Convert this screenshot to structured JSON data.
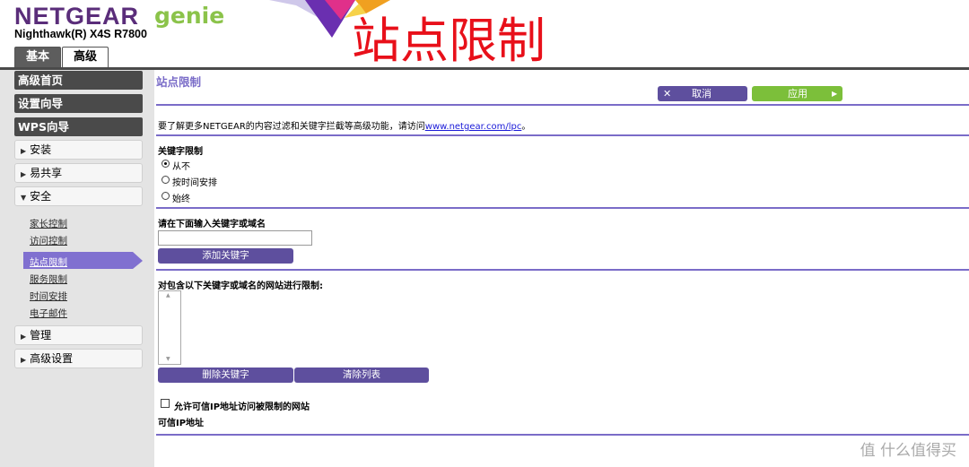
{
  "header": {
    "brand": "NETGEAR",
    "brand_genie": "genie",
    "model": "Nighthawk(R) X4S R7800",
    "banner_title": "站点限制",
    "tabs": [
      "基本",
      "高级"
    ]
  },
  "sidebar": {
    "dark_items": [
      "高级首页",
      "设置向导",
      "WPS向导"
    ],
    "sections": [
      "安装",
      "易共享",
      "安全"
    ],
    "security_sub": [
      "家长控制",
      "访问控制",
      "站点限制",
      "服务限制",
      "时间安排",
      "电子邮件"
    ],
    "bottom_sections": [
      "管理",
      "高级设置"
    ]
  },
  "main": {
    "title": "站点限制",
    "cancel_label": "取消",
    "apply_label": "应用",
    "info_prefix": "要了解更多NETGEAR的内容过滤和关键字拦截等高级功能，请访问",
    "info_link": "www.netgear.com/lpc",
    "info_suffix": "。",
    "keyword_block_label": "关键字限制",
    "radio_options": [
      "从不",
      "按时间安排",
      "始终"
    ],
    "selected_option": "从不",
    "enter_label": "请在下面输入关键字或域名",
    "add_button": "添加关键字",
    "list_label": "对包含以下关键字或域名的网站进行限制:",
    "delete_button": "删除关键字",
    "clear_button": "清除列表",
    "trusted_checkbox": "允许可信IP地址访问被限制的网站",
    "trusted_ip_label": "可信IP地址"
  },
  "watermark": "值 什么值得买",
  "colors": {
    "brand_purple": "#5a2d7a",
    "genie_green": "#8bc34a",
    "accent_purple": "#7a6cc8",
    "button_purple": "#5e4f9e",
    "apply_green": "#7cbf3a",
    "banner_red": "#e8101a"
  }
}
